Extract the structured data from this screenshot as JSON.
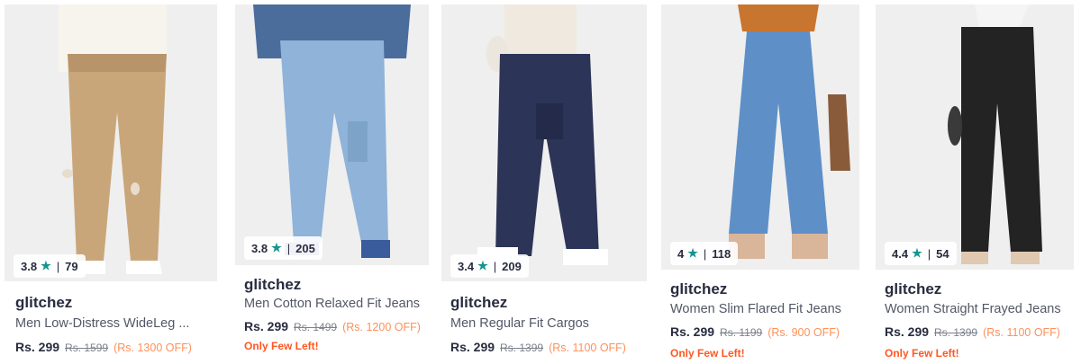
{
  "products": [
    {
      "brand": "glitchez",
      "title": "Men Low-Distress WideLeg ...",
      "price": "Rs. 299",
      "mrp": "Rs. 1599",
      "off": "(Rs. 1300 OFF)",
      "rating": "3.8",
      "reviews": "79",
      "badge": ""
    },
    {
      "brand": "glitchez",
      "title": "Men Cotton Relaxed Fit Jeans",
      "price": "Rs. 299",
      "mrp": "Rs. 1499",
      "off": "(Rs. 1200 OFF)",
      "rating": "3.8",
      "reviews": "205",
      "badge": "Only Few Left!"
    },
    {
      "brand": "glitchez",
      "title": "Men Regular Fit Cargos",
      "price": "Rs. 299",
      "mrp": "Rs. 1399",
      "off": "(Rs. 1100 OFF)",
      "rating": "3.4",
      "reviews": "209",
      "badge": ""
    },
    {
      "brand": "glitchez",
      "title": "Women Slim Flared Fit Jeans",
      "price": "Rs. 299",
      "mrp": "Rs. 1199",
      "off": "(Rs. 900 OFF)",
      "rating": "4",
      "reviews": "118",
      "badge": "Only Few Left!"
    },
    {
      "brand": "glitchez",
      "title": "Women Straight Frayed Jeans",
      "price": "Rs. 299",
      "mrp": "Rs. 1399",
      "off": "(Rs. 1100 OFF)",
      "rating": "4.4",
      "reviews": "54",
      "badge": "Only Few Left!"
    }
  ],
  "colors": {
    "rating_star": "#14958f",
    "discount": "#ff905a",
    "urgency": "#ff5722",
    "text": "#282c3f"
  },
  "icons": {
    "rating": "star-icon"
  }
}
